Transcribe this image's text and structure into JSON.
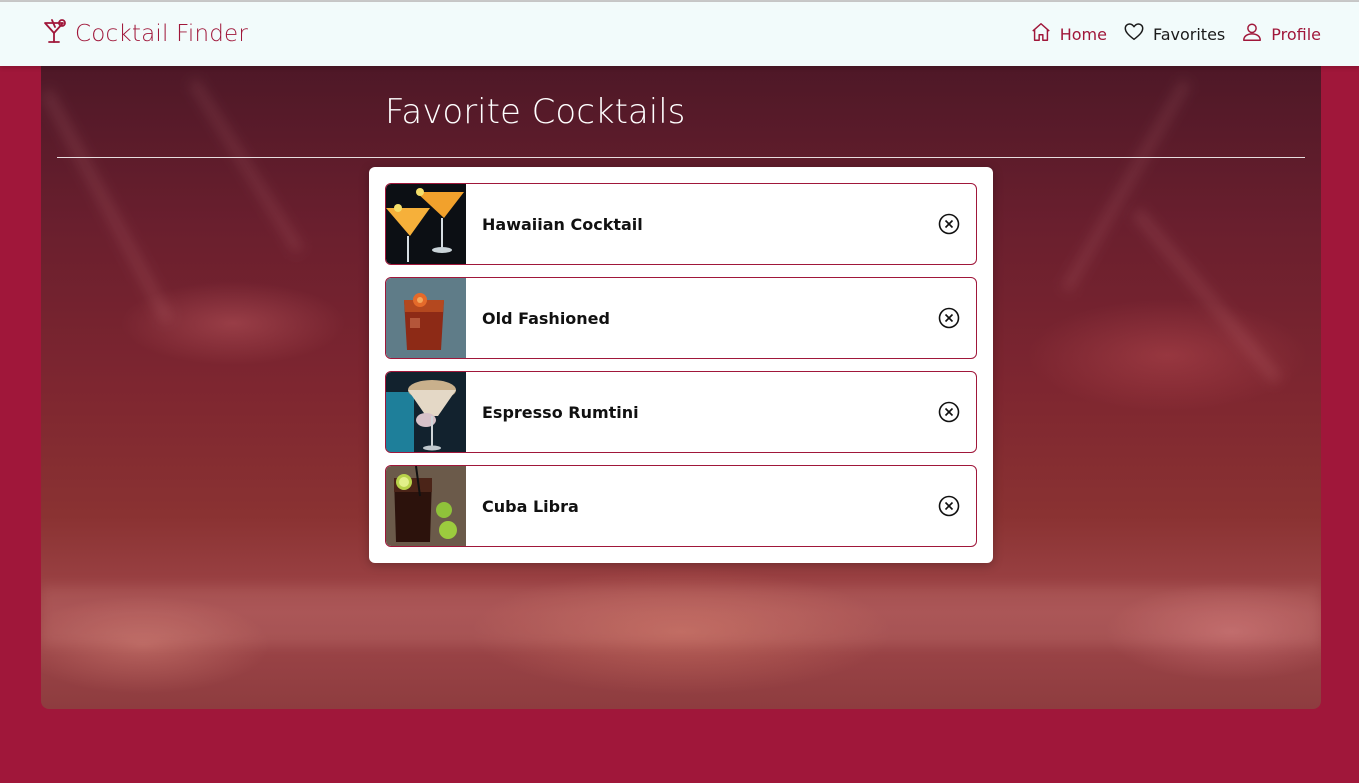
{
  "app": {
    "brand": "Cocktail Finder",
    "brand_icon": "cocktail-glass-icon",
    "accent_color": "#a0173a"
  },
  "nav": {
    "items": [
      {
        "label": "Home",
        "icon": "home-icon",
        "color": "#a0173a"
      },
      {
        "label": "Favorites",
        "icon": "heart-icon",
        "color": "#1b1b1b"
      },
      {
        "label": "Profile",
        "icon": "user-icon",
        "color": "#a0173a"
      }
    ]
  },
  "page": {
    "title": "Favorite Cocktails"
  },
  "favorites": [
    {
      "name": "Hawaiian Cocktail",
      "remove_icon": "remove-circle-x-icon"
    },
    {
      "name": "Old Fashioned",
      "remove_icon": "remove-circle-x-icon"
    },
    {
      "name": "Espresso Rumtini",
      "remove_icon": "remove-circle-x-icon"
    },
    {
      "name": "Cuba Libra",
      "remove_icon": "remove-circle-x-icon"
    }
  ]
}
